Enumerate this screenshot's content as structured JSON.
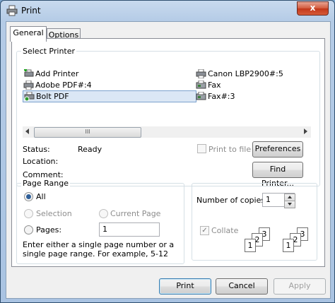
{
  "window": {
    "title": "Print",
    "close_label": "x"
  },
  "tabs": [
    {
      "label": "General"
    },
    {
      "label": "Options"
    }
  ],
  "select_printer": {
    "group_label": "Select Printer",
    "printers": [
      {
        "name": "Add Printer",
        "icon": "add-printer-icon"
      },
      {
        "name": "Adobe PDF#:4",
        "icon": "printer-icon"
      },
      {
        "name": "Bolt PDF",
        "icon": "printer-default-icon",
        "selected": true
      },
      {
        "name": "Canon LBP2900#:5",
        "icon": "printer-icon"
      },
      {
        "name": "Fax",
        "icon": "fax-icon"
      },
      {
        "name": "Fax#:3",
        "icon": "fax-icon"
      }
    ],
    "scroll_thumb_glyph": "III",
    "status_label": "Status:",
    "status_value": "Ready",
    "location_label": "Location:",
    "comment_label": "Comment:",
    "print_to_file_label": "Print to file",
    "preferences_label": "Preferences",
    "find_printer_label": "Find Printer..."
  },
  "page_range": {
    "group_label": "Page Range",
    "all_label": "All",
    "selection_label": "Selection",
    "current_page_label": "Current Page",
    "pages_label": "Pages:",
    "pages_value": "1",
    "hint": "Enter either a single page number or a single page range.  For example, 5-12"
  },
  "copies": {
    "label": "Number of copies:",
    "value": "1",
    "collate_label": "Collate",
    "collate_pages": [
      "1",
      "2",
      "3"
    ]
  },
  "footer": {
    "print_label": "Print",
    "cancel_label": "Cancel",
    "apply_label": "Apply"
  }
}
